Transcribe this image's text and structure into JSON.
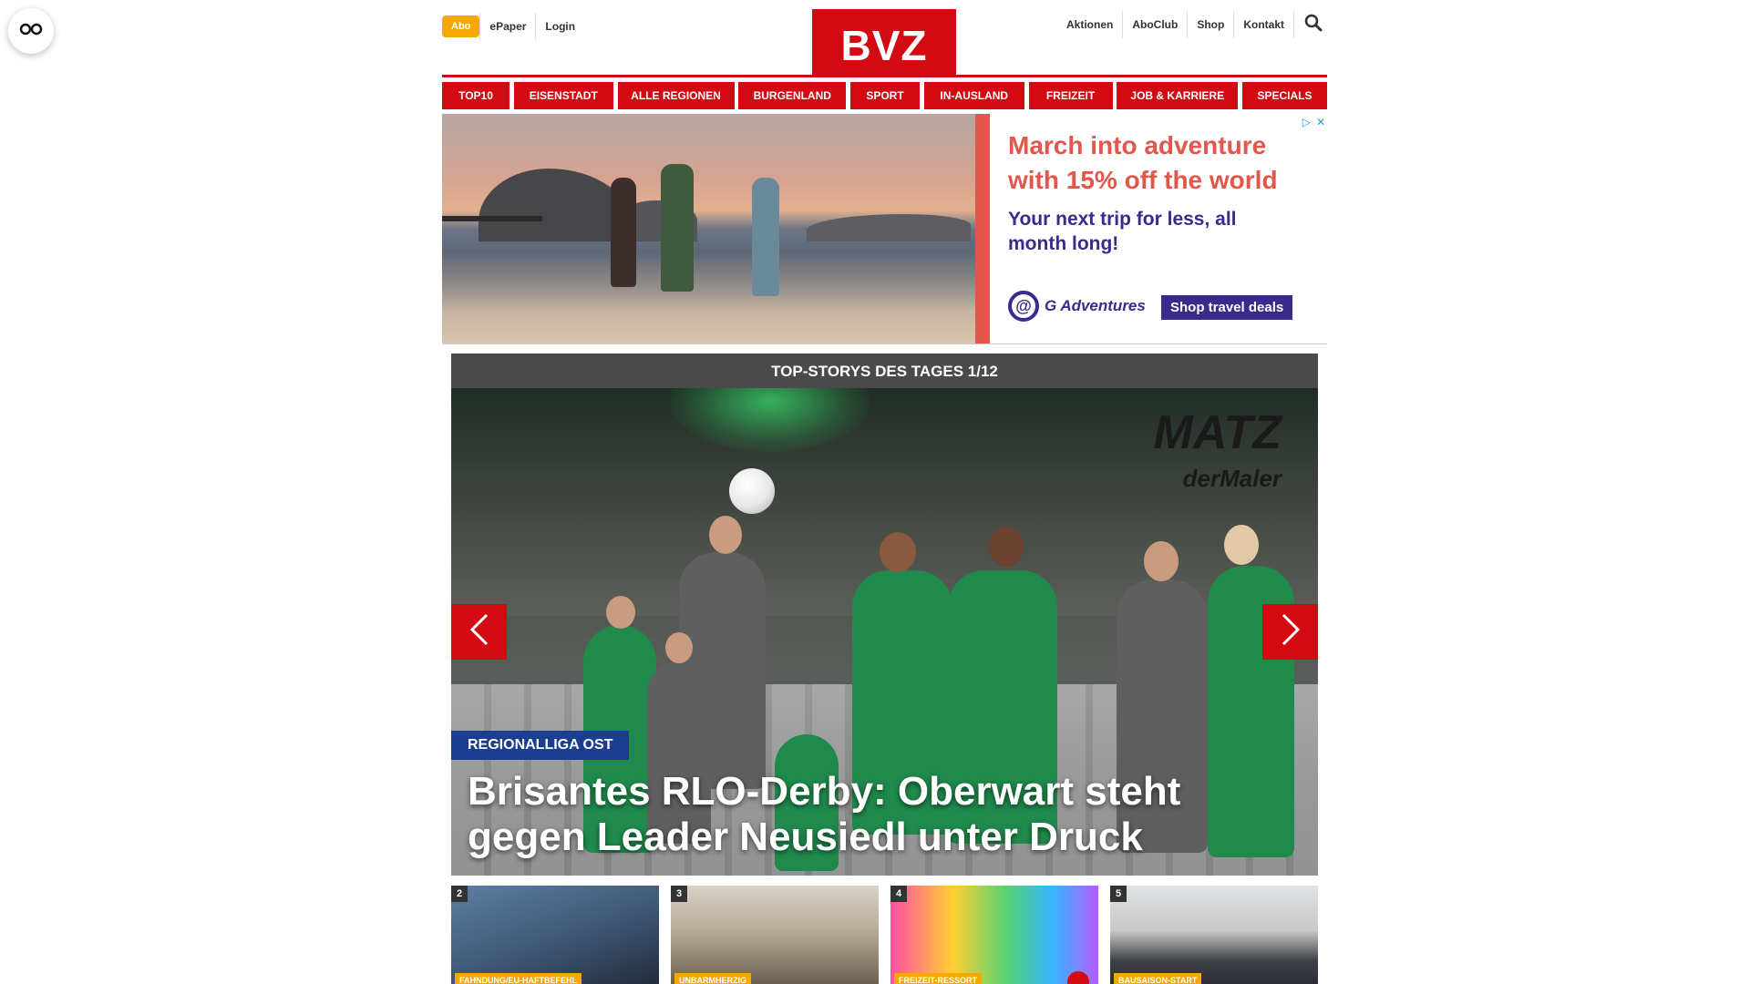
{
  "header": {
    "abo": "Abo",
    "left_links": [
      "ePaper",
      "Login"
    ],
    "logo": "BVZ",
    "right_links": [
      "Aktionen",
      "AboClub",
      "Shop",
      "Kontakt"
    ],
    "brand_color": "#d20a11",
    "abo_color": "#f5a800"
  },
  "nav": {
    "items": [
      "TOP10",
      "EISENSTADT",
      "ALLE REGIONEN",
      "BURGENLAND",
      "SPORT",
      "IN-AUSLAND",
      "FREIZEIT",
      "JOB & KARRIERE",
      "SPECIALS"
    ]
  },
  "ad": {
    "headline": "March into adventure with 15% off the world",
    "subline": "Your next trip for less, all month long!",
    "brand": "G Adventures",
    "cta": "Shop travel deals",
    "accent_color": "#e2574c",
    "brand_color": "#3a2a8c"
  },
  "stories": {
    "header": "TOP-STORYS DES TAGES 1/12",
    "hero": {
      "tag": "REGIONALLIGA OST",
      "title": "Brisantes RLO-Derby: Oberwart steht gegen Leader Neusiedl unter Druck",
      "sponsor_line1": "MATZ",
      "sponsor_line2": "derMaler"
    },
    "thumbs": [
      {
        "num": "2",
        "cat": "FAHNDUNG/EU-HAFTBEFEHL"
      },
      {
        "num": "3",
        "cat": "UNBARMHERZIG"
      },
      {
        "num": "4",
        "cat": "FREIZEIT-RESSORT"
      },
      {
        "num": "5",
        "cat": "BAUSAISON-START"
      }
    ]
  }
}
